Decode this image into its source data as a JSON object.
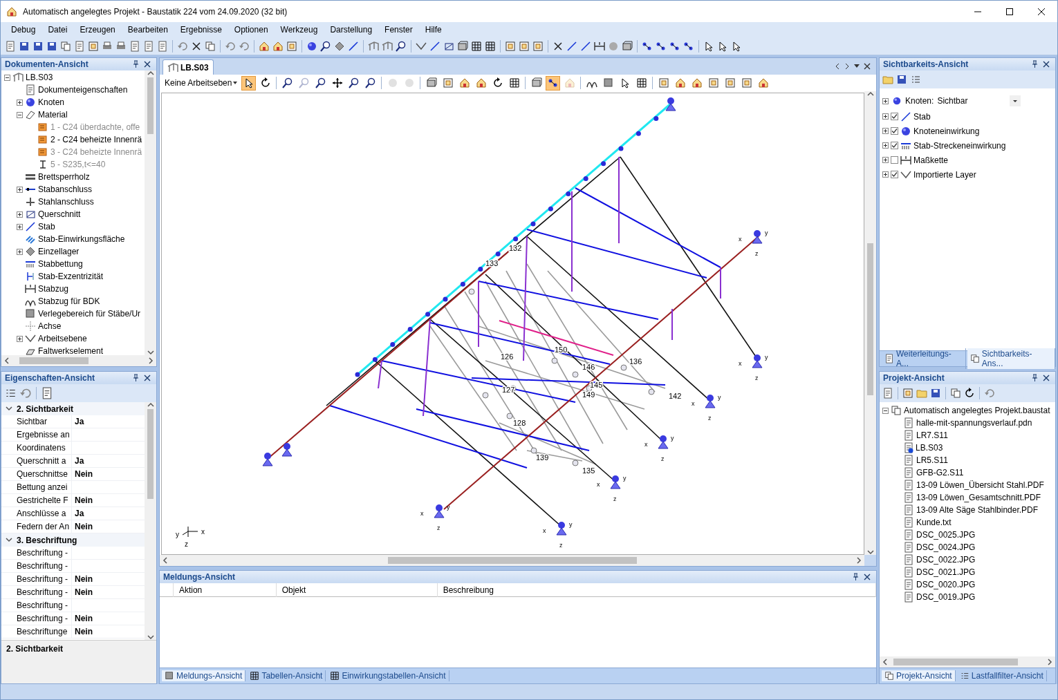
{
  "window": {
    "title": "Automatisch angelegtes Projekt - Baustatik 224 vom 24.09.2020 (32 bit)"
  },
  "menu": [
    "Debug",
    "Datei",
    "Erzeugen",
    "Bearbeiten",
    "Ergebnisse",
    "Optionen",
    "Werkzeug",
    "Darstellung",
    "Fenster",
    "Hilfe"
  ],
  "documents_panel": {
    "title": "Dokumenten-Ansicht",
    "tree": [
      {
        "label": "LB.S03",
        "expanded": true,
        "children": [
          {
            "label": "Dokumenteigenschaften"
          },
          {
            "label": "Knoten",
            "expanded": false
          },
          {
            "label": "Material",
            "expanded": true,
            "children": [
              {
                "label": "1 - C24 überdachte, offe",
                "dimmed": true
              },
              {
                "label": "2 - C24 beheizte Innenrä",
                "dimmed": false
              },
              {
                "label": "3 - C24 beheizte Innenrä",
                "dimmed": true
              },
              {
                "label": "5 - S235,t<=40",
                "dimmed": true
              }
            ]
          },
          {
            "label": "Brettsperrholz"
          },
          {
            "label": "Stabanschluss",
            "expanded": false
          },
          {
            "label": "Stahlanschluss"
          },
          {
            "label": "Querschnitt",
            "expanded": false
          },
          {
            "label": "Stab",
            "expanded": false
          },
          {
            "label": "Stab-Einwirkungsfläche"
          },
          {
            "label": "Einzellager",
            "expanded": false
          },
          {
            "label": "Stabbettung"
          },
          {
            "label": "Stab-Exzentrizität"
          },
          {
            "label": "Stabzug"
          },
          {
            "label": "Stabzug für BDK"
          },
          {
            "label": "Verlegebereich für Stäbe/Ur"
          },
          {
            "label": "Achse"
          },
          {
            "label": "Arbeitsebene",
            "expanded": false
          },
          {
            "label": "Faltwerkselement"
          }
        ]
      }
    ]
  },
  "properties_panel": {
    "title": "Eigenschaften-Ansicht",
    "groups": [
      {
        "title": "2. Sichtbarkeit",
        "expanded": true,
        "rows": [
          {
            "name": "Sichtbar",
            "value": "Ja"
          },
          {
            "name": "Ergebnisse an"
          },
          {
            "name": "Koordinatens"
          },
          {
            "name": "Querschnitt a",
            "value": "Ja"
          },
          {
            "name": "Querschnittse",
            "value": "Nein"
          },
          {
            "name": "Bettung anzei"
          },
          {
            "name": "Gestrichelte F",
            "value": "Nein"
          },
          {
            "name": "Anschlüsse a",
            "value": "Ja"
          },
          {
            "name": "Federn der An",
            "value": "Nein"
          }
        ]
      },
      {
        "title": "3. Beschriftung",
        "expanded": true,
        "rows": [
          {
            "name": "Beschriftung -"
          },
          {
            "name": "Beschriftung -"
          },
          {
            "name": "Beschriftung -",
            "value": "Nein"
          },
          {
            "name": "Beschriftung -",
            "value": "Nein"
          },
          {
            "name": "Beschriftung -"
          },
          {
            "name": "Beschriftung -",
            "value": "Nein"
          },
          {
            "name": "Beschriftunge",
            "value": "Nein"
          }
        ]
      }
    ],
    "description": "2. Sichtbarkeit"
  },
  "document_tabs": [
    {
      "label": "LB.S03",
      "selected": true
    }
  ],
  "view_toolbar": {
    "workplane": "Keine Arbeitseben",
    "buttons": [
      {
        "selected": true,
        "disabled": false
      },
      {
        "selected": false,
        "disabled": false
      },
      {
        "selected": false,
        "disabled": false
      },
      {
        "selected": false,
        "disabled": true
      },
      {
        "selected": false,
        "disabled": false
      },
      {
        "selected": false,
        "disabled": false
      },
      {
        "selected": false,
        "disabled": false
      },
      {
        "selected": false,
        "disabled": false
      },
      {
        "selected": false,
        "disabled": true
      },
      {
        "selected": false,
        "disabled": true
      },
      {
        "selected": false,
        "disabled": false
      },
      {
        "selected": false,
        "disabled": false
      },
      {
        "selected": false,
        "disabled": false
      },
      {
        "selected": false,
        "disabled": false
      },
      {
        "selected": false,
        "disabled": false
      },
      {
        "selected": false,
        "disabled": false
      },
      {
        "selected": false,
        "disabled": false
      },
      {
        "selected": true,
        "disabled": false
      },
      {
        "selected": false,
        "disabled": true
      },
      {
        "selected": false,
        "disabled": false
      },
      {
        "selected": false,
        "disabled": false
      },
      {
        "selected": false,
        "disabled": false
      },
      {
        "selected": false,
        "disabled": false
      },
      {
        "selected": false,
        "disabled": false
      },
      {
        "selected": false,
        "disabled": false
      },
      {
        "selected": false,
        "disabled": false
      },
      {
        "selected": false,
        "disabled": false
      },
      {
        "selected": false,
        "disabled": false
      },
      {
        "selected": false,
        "disabled": false
      },
      {
        "selected": false,
        "disabled": false
      }
    ]
  },
  "viewport": {
    "node_labels": [
      "132",
      "133",
      "126",
      "127",
      "128",
      "150",
      "146",
      "145",
      "149",
      "136",
      "142",
      "139",
      "135"
    ],
    "supports": [
      {
        "x": "x",
        "y": "y",
        "z": "z"
      },
      {
        "x": "x",
        "y": "y",
        "z": "z"
      },
      {
        "x": "x",
        "y": "y",
        "z": "z"
      },
      {
        "x": "x",
        "y": "y",
        "z": "z"
      },
      {
        "x": "x",
        "y": "y",
        "z": "z"
      },
      {
        "x": "x",
        "y": "y",
        "z": "z"
      },
      {
        "x": "x",
        "y": "y",
        "z": "z"
      }
    ],
    "axis": {
      "x": "x",
      "y": "y",
      "z": "z"
    }
  },
  "messages_panel": {
    "title": "Meldungs-Ansicht",
    "columns": [
      "Aktion",
      "Objekt",
      "Beschreibung"
    ],
    "tabs": [
      {
        "label": "Meldungs-Ansicht",
        "selected": true
      },
      {
        "label": "Tabellen-Ansicht",
        "selected": false
      },
      {
        "label": "Einwirkungstabellen-Ansicht",
        "selected": false
      }
    ]
  },
  "visibility_panel": {
    "title": "Sichtbarkeits-Ansicht",
    "node_filter": {
      "label": "Knoten:",
      "value": "Sichtbar"
    },
    "layers": [
      {
        "label": "Stab",
        "checked": true
      },
      {
        "label": "Knoteneinwirkung",
        "checked": true
      },
      {
        "label": "Stab-Streckeneinwirkung",
        "checked": true
      },
      {
        "label": "Maßkette",
        "checked": false
      },
      {
        "label": "Importierte Layer",
        "checked": true
      }
    ],
    "tabs": [
      {
        "label": "Weiterleitungs-A...",
        "selected": false
      },
      {
        "label": "Sichtbarkeits-Ans...",
        "selected": true
      }
    ]
  },
  "project_panel": {
    "title": "Projekt-Ansicht",
    "tree": [
      {
        "label": "Automatisch angelegtes Projekt.baustat",
        "expanded": true,
        "children": [
          {
            "label": "halle-mit-spannungsverlauf.pdn",
            "active": false
          },
          {
            "label": "LR7.S11",
            "active": false
          },
          {
            "label": "LB.S03",
            "active": true
          },
          {
            "label": "LR5.S11",
            "active": false
          },
          {
            "label": "GFB-G2.S11",
            "active": false
          },
          {
            "label": "13-09 Löwen_Übersicht Stahl.PDF",
            "active": false
          },
          {
            "label": "13-09 Löwen_Gesamtschnitt.PDF",
            "active": false
          },
          {
            "label": "13-09 Alte Säge Stahlbinder.PDF",
            "active": false
          },
          {
            "label": "Kunde.txt",
            "active": false
          },
          {
            "label": "DSC_0025.JPG",
            "active": false
          },
          {
            "label": "DSC_0024.JPG",
            "active": false
          },
          {
            "label": "DSC_0022.JPG",
            "active": false
          },
          {
            "label": "DSC_0021.JPG",
            "active": false
          },
          {
            "label": "DSC_0020.JPG",
            "active": false
          },
          {
            "label": "DSC_0019.JPG",
            "active": false
          }
        ]
      }
    ],
    "tabs": [
      {
        "label": "Projekt-Ansicht",
        "selected": true
      },
      {
        "label": "Lastfallfilter-Ansicht",
        "selected": false
      }
    ]
  }
}
